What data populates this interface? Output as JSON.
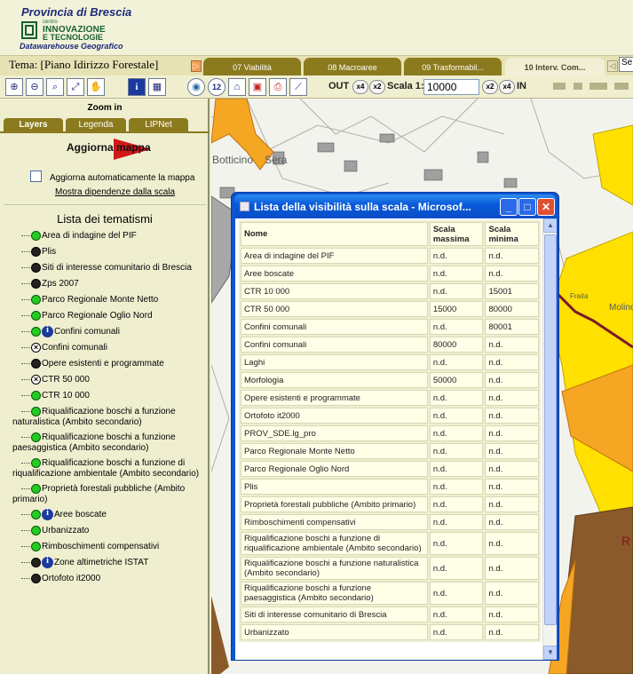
{
  "header": {
    "province": "Provincia di Brescia",
    "center_small": "centro",
    "innovazione": "INNOVAZIONE",
    "tecnologie": "E TECNOLOGIE",
    "datawarehouse": "Datawarehouse Geografico"
  },
  "tabbar": {
    "tema": "Tema: [Piano Idirizzo Forestale]",
    "tabs": [
      {
        "label": "07 Viabilità",
        "active": false
      },
      {
        "label": "08 Macroaree",
        "active": false
      },
      {
        "label": "09 Trasformabil...",
        "active": false
      },
      {
        "label": "10 Interv. Com...",
        "active": true
      }
    ],
    "search_value": "Se"
  },
  "toolbar": {
    "out_label": "OUT",
    "in_label": "IN",
    "scale_label": "Scala 1:",
    "scale_value": "10000",
    "factor_x4": "x4",
    "factor_x2": "x2",
    "date_icon_text": "12"
  },
  "left_panel": {
    "zoom_label": "Zoom in",
    "tabs": [
      "Layers",
      "Legenda",
      "LIPNet"
    ],
    "update_button": "Aggiorna mappa",
    "auto_update_label": "Aggiorna automaticamente la mappa",
    "scale_dependency_link": "Mostra dipendenze dalla scala",
    "list_title": "Lista dei tematismi",
    "layers": [
      {
        "label": "Area di indagine del PIF",
        "icon": "green-dot"
      },
      {
        "label": "Plis",
        "icon": "black-dot"
      },
      {
        "label": "Siti di interesse comunitario di Brescia",
        "icon": "black-dot"
      },
      {
        "label": "Zps 2007",
        "icon": "black-dot"
      },
      {
        "label": "Parco Regionale Monte Netto",
        "icon": "green-dot"
      },
      {
        "label": "Parco Regionale Oglio Nord",
        "icon": "green-dot"
      },
      {
        "label": "Confini comunali",
        "icon": "green-dot-info"
      },
      {
        "label": "Confini comunali",
        "icon": "x-dot"
      },
      {
        "label": "Opere esistenti e programmate",
        "icon": "black-dot"
      },
      {
        "label": "CTR 50 000",
        "icon": "x-dot"
      },
      {
        "label": "CTR 10 000",
        "icon": "green-dot"
      },
      {
        "label": "Riqualificazione boschi a funzione",
        "label2": "naturalistica (Ambito secondario)",
        "icon": "green-dot"
      },
      {
        "label": "Riqualificazione boschi a funzione",
        "label2": "paesaggistica (Ambito secondario)",
        "icon": "green-dot"
      },
      {
        "label": "Riqualificazione boschi a funzione di",
        "label2": "riqualificazione ambientale (Ambito secondario)",
        "icon": "green-dot"
      },
      {
        "label": "Proprietà forestali pubbliche (Ambito",
        "label2": "primario)",
        "icon": "green-dot"
      },
      {
        "label": "Aree boscate",
        "icon": "green-dot-info"
      },
      {
        "label": "Urbanizzato",
        "icon": "green-dot"
      },
      {
        "label": "Rimboschimenti compensativi",
        "icon": "green-dot"
      },
      {
        "label": "Zone altimetriche ISTAT",
        "icon": "black-dot-info"
      },
      {
        "label": "Ortofoto it2000",
        "icon": "black-dot"
      }
    ]
  },
  "map": {
    "labels": [
      "Botticino",
      "Sera",
      "Fraita",
      "Molino",
      "R"
    ]
  },
  "popup": {
    "title": "Lista della visibilità sulla scala - Microsof...",
    "columns": [
      "Nome",
      "Scala massima",
      "Scala minima"
    ],
    "rows": [
      [
        "Area di indagine del PIF",
        "n.d.",
        "n.d."
      ],
      [
        "Aree boscate",
        "n.d.",
        "n.d."
      ],
      [
        "CTR 10 000",
        "n.d.",
        "15001"
      ],
      [
        "CTR 50 000",
        "15000",
        "80000"
      ],
      [
        "Confini comunali",
        "n.d.",
        "80001"
      ],
      [
        "Confini comunali",
        "80000",
        "n.d."
      ],
      [
        "Laghi",
        "n.d.",
        "n.d."
      ],
      [
        "Morfologia",
        "50000",
        "n.d."
      ],
      [
        "Opere esistenti e programmate",
        "n.d.",
        "n.d."
      ],
      [
        "Ortofoto it2000",
        "n.d.",
        "n.d."
      ],
      [
        "PROV_SDE.lg_pro",
        "n.d.",
        "n.d."
      ],
      [
        "Parco Regionale Monte Netto",
        "n.d.",
        "n.d."
      ],
      [
        "Parco Regionale Oglio Nord",
        "n.d.",
        "n.d."
      ],
      [
        "Plis",
        "n.d.",
        "n.d."
      ],
      [
        "Proprietà forestali pubbliche (Ambito primario)",
        "n.d.",
        "n.d."
      ],
      [
        "Rimboschimenti compensativi",
        "n.d.",
        "n.d."
      ],
      [
        "Riqualificazione boschi a funzione di riqualificazione ambientale (Ambito secondario)",
        "n.d.",
        "n.d."
      ],
      [
        "Riqualificazione boschi a funzione naturalistica (Ambito secondario)",
        "n.d.",
        "n.d."
      ],
      [
        "Riqualificazione boschi a funzione paesaggistica (Ambito secondario)",
        "n.d.",
        "n.d."
      ],
      [
        "Siti di interesse comunitario di Brescia",
        "n.d.",
        "n.d."
      ],
      [
        "Urbanizzato",
        "n.d.",
        "n.d."
      ]
    ]
  },
  "colors": {
    "header_bg": "#f2f2d8",
    "tab_olive": "#8b7a1e",
    "panel_bg": "#efefd0",
    "xp_title": "#0758d8",
    "update_arrow": "#d01818",
    "map_orange": "#f5a623",
    "map_yellow": "#ffe000",
    "map_brown": "#8a5a2a"
  }
}
